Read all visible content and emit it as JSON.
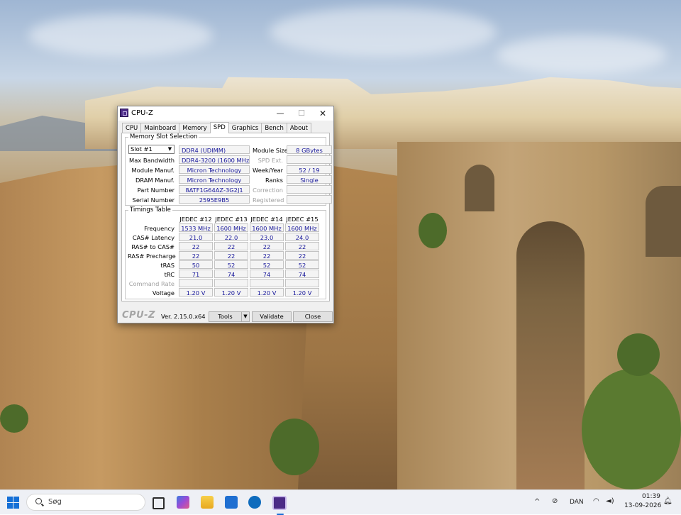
{
  "window": {
    "title": "CPU-Z",
    "min_glyph": "—",
    "max_glyph": "☐",
    "close_glyph": "✕"
  },
  "tabs": [
    "CPU",
    "Mainboard",
    "Memory",
    "SPD",
    "Graphics",
    "Bench",
    "About"
  ],
  "active_tab": "SPD",
  "slot_selection": {
    "legend": "Memory Slot Selection",
    "slot_value": "Slot #1",
    "module_type": "DDR4 (UDIMM)",
    "max_bandwidth_label": "Max Bandwidth",
    "max_bandwidth": "DDR4-3200 (1600 MHz)",
    "module_manuf_label": "Module Manuf.",
    "module_manuf": "Micron Technology",
    "dram_manuf_label": "DRAM Manuf.",
    "dram_manuf": "Micron Technology",
    "part_number_label": "Part Number",
    "part_number": "8ATF1G64AZ-3G2J1",
    "serial_number_label": "Serial Number",
    "serial_number": "2595E9B5",
    "module_size_label": "Module Size",
    "module_size": "8 GBytes",
    "spd_ext_label": "SPD Ext.",
    "spd_ext": "",
    "week_year_label": "Week/Year",
    "week_year": "52 / 19",
    "ranks_label": "Ranks",
    "ranks": "Single",
    "correction_label": "Correction",
    "correction": "",
    "registered_label": "Registered",
    "registered": ""
  },
  "timings": {
    "legend": "Timings Table",
    "columns": [
      "JEDEC #12",
      "JEDEC #13",
      "JEDEC #14",
      "JEDEC #15"
    ],
    "rows": [
      {
        "label": "Frequency",
        "values": [
          "1533 MHz",
          "1600 MHz",
          "1600 MHz",
          "1600 MHz"
        ]
      },
      {
        "label": "CAS# Latency",
        "values": [
          "21.0",
          "22.0",
          "23.0",
          "24.0"
        ]
      },
      {
        "label": "RAS# to CAS#",
        "values": [
          "22",
          "22",
          "22",
          "22"
        ]
      },
      {
        "label": "RAS# Precharge",
        "values": [
          "22",
          "22",
          "22",
          "22"
        ]
      },
      {
        "label": "tRAS",
        "values": [
          "50",
          "52",
          "52",
          "52"
        ]
      },
      {
        "label": "tRC",
        "values": [
          "71",
          "74",
          "74",
          "74"
        ]
      },
      {
        "label": "Command Rate",
        "values": [
          "",
          "",
          "",
          ""
        ]
      },
      {
        "label": "Voltage",
        "values": [
          "1.20 V",
          "1.20 V",
          "1.20 V",
          "1.20 V"
        ]
      }
    ]
  },
  "footer": {
    "logo": "CPU-Z",
    "version": "Ver. 2.15.0.x64",
    "tools_label": "Tools",
    "validate_label": "Validate",
    "close_label": "Close"
  },
  "taskbar": {
    "search_placeholder": "Søg",
    "language": "DAN",
    "time": "01:39",
    "date": "13-09-2026",
    "pinned_apps": [
      {
        "name": "task-view",
        "color": "#2b2b2b"
      },
      {
        "name": "m365-copilot",
        "color": "#7a4cc4"
      },
      {
        "name": "file-explorer",
        "color": "#f2b830"
      },
      {
        "name": "microsoft-store",
        "color": "#1f6fd1"
      },
      {
        "name": "outlook",
        "color": "#0f6cbd"
      },
      {
        "name": "cpu-z",
        "color": "#4b2a86"
      }
    ]
  }
}
